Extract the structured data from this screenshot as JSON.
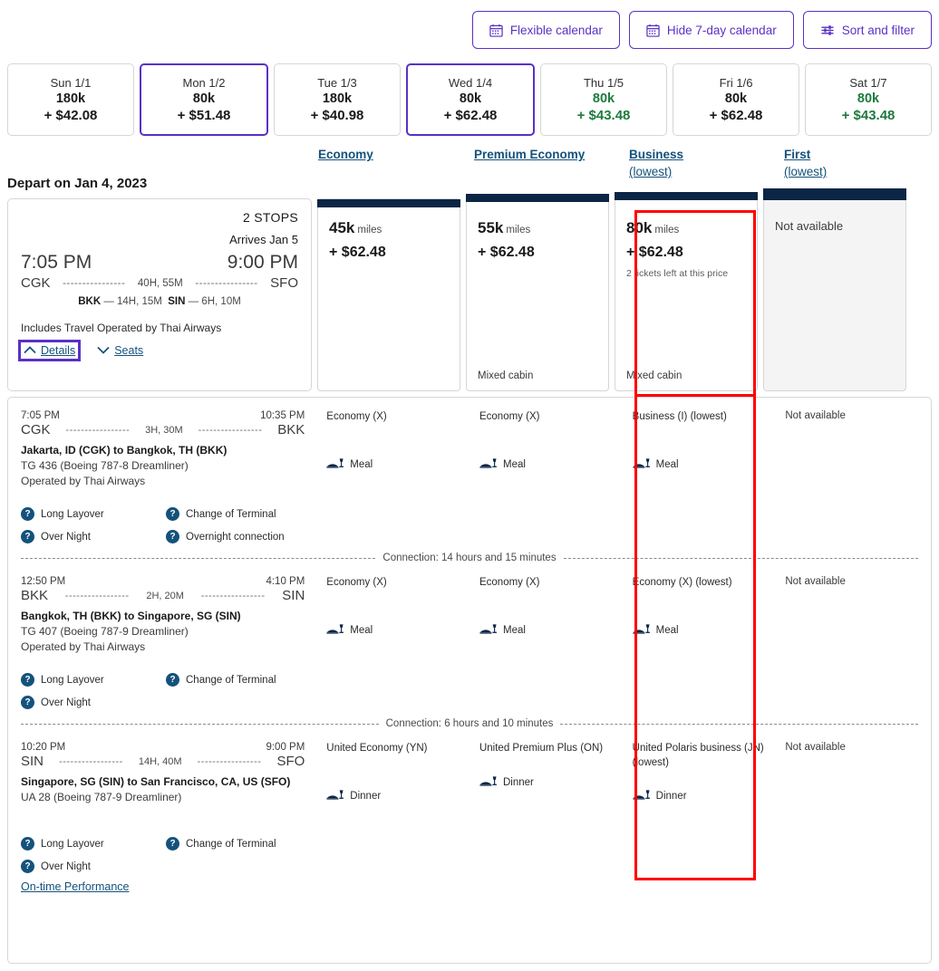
{
  "toolbar": {
    "buttons": [
      {
        "label": "Flexible calendar",
        "icon": "calendar-icon"
      },
      {
        "label": "Hide 7-day calendar",
        "icon": "calendar-icon"
      },
      {
        "label": "Sort and filter",
        "icon": "filter-sliders-icon"
      }
    ]
  },
  "day_strip": [
    {
      "label": "Sun 1/1",
      "miles": "180k",
      "price": "+ $42.08",
      "selected": false,
      "cheap": false
    },
    {
      "label": "Mon 1/2",
      "miles": "80k",
      "price": "+ $51.48",
      "selected": true,
      "cheap": false
    },
    {
      "label": "Tue 1/3",
      "miles": "180k",
      "price": "+ $40.98",
      "selected": false,
      "cheap": false
    },
    {
      "label": "Wed 1/4",
      "miles": "80k",
      "price": "+ $62.48",
      "selected": true,
      "cheap": false
    },
    {
      "label": "Thu 1/5",
      "miles": "80k",
      "price": "+ $43.48",
      "selected": false,
      "cheap": true
    },
    {
      "label": "Fri 1/6",
      "miles": "80k",
      "price": "+ $62.48",
      "selected": false,
      "cheap": false
    },
    {
      "label": "Sat 1/7",
      "miles": "80k",
      "price": "+ $43.48",
      "selected": false,
      "cheap": true
    }
  ],
  "cabin_tabs": [
    {
      "label": "Economy",
      "sub": ""
    },
    {
      "label": "Premium Economy",
      "sub": ""
    },
    {
      "label": "Business",
      "sub": "(lowest)"
    },
    {
      "label": "First",
      "sub": "(lowest)"
    }
  ],
  "depart_heading": "Depart on Jan 4, 2023",
  "itinerary": {
    "stops": "2 STOPS",
    "arrives": "Arrives Jan 5",
    "depart_time": "7:05 PM",
    "arrive_time": "9:00 PM",
    "origin": "CGK",
    "destination": "SFO",
    "duration": "40H, 55M",
    "dashes": "----------------",
    "leg_stops": [
      {
        "code": "BKK",
        "dur": "14H, 15M"
      },
      {
        "code": "SIN",
        "dur": "6H, 10M"
      }
    ],
    "operated_note": "Includes Travel Operated by Thai Airways",
    "details_label": "Details",
    "seats_label": "Seats"
  },
  "fare_cards": [
    {
      "miles": "45k",
      "unit": "miles",
      "price": "+ $62.48",
      "note": "",
      "mixed": "",
      "available": true,
      "selected": false,
      "unavailable_label": ""
    },
    {
      "miles": "55k",
      "unit": "miles",
      "price": "+ $62.48",
      "note": "",
      "mixed": "Mixed cabin",
      "available": true,
      "selected": false,
      "unavailable_label": ""
    },
    {
      "miles": "80k",
      "unit": "miles",
      "price": "+ $62.48",
      "note": "2 tickets left at this price",
      "mixed": "Mixed cabin",
      "available": true,
      "selected": true,
      "unavailable_label": ""
    },
    {
      "miles": "",
      "unit": "",
      "price": "",
      "note": "",
      "mixed": "",
      "available": false,
      "selected": false,
      "unavailable_label": "Not available"
    }
  ],
  "segments": [
    {
      "depart_time": "7:05 PM",
      "arrive_time": "10:35 PM",
      "origin": "CGK",
      "destination": "BKK",
      "duration": "3H, 30M",
      "dashes": "-----------------",
      "city_pair": "Jakarta, ID (CGK) to Bangkok, TH (BKK)",
      "equipment": "TG 436 (Boeing 787-8 Dreamliner)",
      "operated_by": "Operated by Thai Airways",
      "badges": [
        "Long Layover",
        "Change of Terminal",
        "Over Night",
        "Overnight connection"
      ],
      "cabins": [
        {
          "name": "Economy (X)",
          "meal": "Meal",
          "available": true
        },
        {
          "name": "Economy (X)",
          "meal": "Meal",
          "available": true
        },
        {
          "name": "Business (I) (lowest)",
          "meal": "Meal",
          "available": true
        },
        {
          "name": "Not available",
          "meal": "",
          "available": false
        }
      ],
      "connection_after": "Connection: 14 hours and 15 minutes"
    },
    {
      "depart_time": "12:50 PM",
      "arrive_time": "4:10 PM",
      "origin": "BKK",
      "destination": "SIN",
      "duration": "2H, 20M",
      "dashes": "-----------------",
      "city_pair": "Bangkok, TH (BKK) to Singapore, SG (SIN)",
      "equipment": "TG 407 (Boeing 787-9 Dreamliner)",
      "operated_by": "Operated by Thai Airways",
      "badges": [
        "Long Layover",
        "Change of Terminal",
        "Over Night"
      ],
      "cabins": [
        {
          "name": "Economy (X)",
          "meal": "Meal",
          "available": true
        },
        {
          "name": "Economy (X)",
          "meal": "Meal",
          "available": true
        },
        {
          "name": "Economy (X) (lowest)",
          "meal": "Meal",
          "available": true
        },
        {
          "name": "Not available",
          "meal": "",
          "available": false
        }
      ],
      "connection_after": "Connection: 6 hours and 10 minutes"
    },
    {
      "depart_time": "10:20 PM",
      "arrive_time": "9:00 PM",
      "origin": "SIN",
      "destination": "SFO",
      "duration": "14H, 40M",
      "dashes": "-----------------",
      "city_pair": "Singapore, SG (SIN) to San Francisco, CA, US (SFO)",
      "equipment": "UA 28 (Boeing 787-9 Dreamliner)",
      "operated_by": "",
      "badges": [
        "Long Layover",
        "Change of Terminal",
        "Over Night"
      ],
      "cabins": [
        {
          "name": "United Economy (YN)",
          "meal": "Dinner",
          "available": true
        },
        {
          "name": "United Premium Plus (ON)",
          "meal": "Dinner",
          "available": true
        },
        {
          "name": "United Polaris business (JN) (lowest)",
          "meal": "Dinner",
          "available": true
        },
        {
          "name": "Not available",
          "meal": "",
          "available": false
        }
      ],
      "connection_after": ""
    }
  ],
  "on_time_performance": "On-time Performance",
  "colors": {
    "brand_purple": "#5a31c5",
    "link_blue": "#14527c",
    "navy": "#0b2545",
    "green": "#1d7a3e",
    "highlight_red": "#ff0000"
  }
}
